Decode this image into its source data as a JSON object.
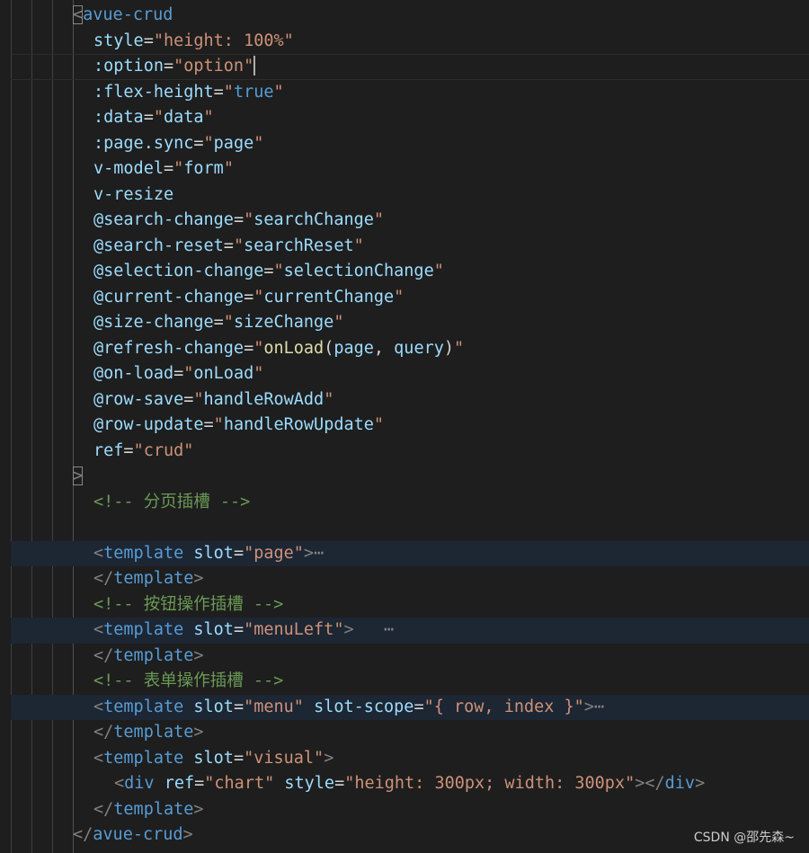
{
  "editor": {
    "lines": [
      {
        "indent": 1,
        "tokens": [
          {
            "t": "<",
            "c": "punct",
            "box": true
          },
          {
            "t": "avue-crud",
            "c": "tag"
          }
        ]
      },
      {
        "indent": 2,
        "tokens": [
          {
            "t": "style",
            "c": "attr"
          },
          {
            "t": "=",
            "c": "eq"
          },
          {
            "t": "\"height: 100%\"",
            "c": "str"
          }
        ]
      },
      {
        "indent": 2,
        "caret": true,
        "tokens": [
          {
            "t": ":option",
            "c": "attr"
          },
          {
            "t": "=",
            "c": "eq"
          },
          {
            "t": "\"option\"",
            "c": "str"
          }
        ]
      },
      {
        "indent": 2,
        "tokens": [
          {
            "t": ":flex-height",
            "c": "attr"
          },
          {
            "t": "=",
            "c": "eq"
          },
          {
            "t": "\"",
            "c": "str"
          },
          {
            "t": "true",
            "c": "kw"
          },
          {
            "t": "\"",
            "c": "str"
          }
        ]
      },
      {
        "indent": 2,
        "tokens": [
          {
            "t": ":data",
            "c": "attr"
          },
          {
            "t": "=",
            "c": "eq"
          },
          {
            "t": "\"",
            "c": "str"
          },
          {
            "t": "data",
            "c": "var"
          },
          {
            "t": "\"",
            "c": "str"
          }
        ]
      },
      {
        "indent": 2,
        "tokens": [
          {
            "t": ":page.sync",
            "c": "attr"
          },
          {
            "t": "=",
            "c": "eq"
          },
          {
            "t": "\"",
            "c": "str"
          },
          {
            "t": "page",
            "c": "var"
          },
          {
            "t": "\"",
            "c": "str"
          }
        ]
      },
      {
        "indent": 2,
        "tokens": [
          {
            "t": "v-model",
            "c": "attr"
          },
          {
            "t": "=",
            "c": "eq"
          },
          {
            "t": "\"",
            "c": "str"
          },
          {
            "t": "form",
            "c": "var"
          },
          {
            "t": "\"",
            "c": "str"
          }
        ]
      },
      {
        "indent": 2,
        "tokens": [
          {
            "t": "v-resize",
            "c": "attr"
          }
        ]
      },
      {
        "indent": 2,
        "tokens": [
          {
            "t": "@search-change",
            "c": "attr"
          },
          {
            "t": "=",
            "c": "eq"
          },
          {
            "t": "\"",
            "c": "str"
          },
          {
            "t": "searchChange",
            "c": "var"
          },
          {
            "t": "\"",
            "c": "str"
          }
        ]
      },
      {
        "indent": 2,
        "tokens": [
          {
            "t": "@search-reset",
            "c": "attr"
          },
          {
            "t": "=",
            "c": "eq"
          },
          {
            "t": "\"",
            "c": "str"
          },
          {
            "t": "searchReset",
            "c": "var"
          },
          {
            "t": "\"",
            "c": "str"
          }
        ]
      },
      {
        "indent": 2,
        "tokens": [
          {
            "t": "@selection-change",
            "c": "attr"
          },
          {
            "t": "=",
            "c": "eq"
          },
          {
            "t": "\"",
            "c": "str"
          },
          {
            "t": "selectionChange",
            "c": "var"
          },
          {
            "t": "\"",
            "c": "str"
          }
        ]
      },
      {
        "indent": 2,
        "tokens": [
          {
            "t": "@current-change",
            "c": "attr"
          },
          {
            "t": "=",
            "c": "eq"
          },
          {
            "t": "\"",
            "c": "str"
          },
          {
            "t": "currentChange",
            "c": "var"
          },
          {
            "t": "\"",
            "c": "str"
          }
        ]
      },
      {
        "indent": 2,
        "tokens": [
          {
            "t": "@size-change",
            "c": "attr"
          },
          {
            "t": "=",
            "c": "eq"
          },
          {
            "t": "\"",
            "c": "str"
          },
          {
            "t": "sizeChange",
            "c": "var"
          },
          {
            "t": "\"",
            "c": "str"
          }
        ]
      },
      {
        "indent": 2,
        "tokens": [
          {
            "t": "@refresh-change",
            "c": "attr"
          },
          {
            "t": "=",
            "c": "eq"
          },
          {
            "t": "\"",
            "c": "str"
          },
          {
            "t": "onLoad",
            "c": "fn"
          },
          {
            "t": "(",
            "c": "plain"
          },
          {
            "t": "page",
            "c": "var"
          },
          {
            "t": ", ",
            "c": "plain"
          },
          {
            "t": "query",
            "c": "var"
          },
          {
            "t": ")",
            "c": "plain"
          },
          {
            "t": "\"",
            "c": "str"
          }
        ]
      },
      {
        "indent": 2,
        "tokens": [
          {
            "t": "@on-load",
            "c": "attr"
          },
          {
            "t": "=",
            "c": "eq"
          },
          {
            "t": "\"",
            "c": "str"
          },
          {
            "t": "onLoad",
            "c": "var"
          },
          {
            "t": "\"",
            "c": "str"
          }
        ]
      },
      {
        "indent": 2,
        "tokens": [
          {
            "t": "@row-save",
            "c": "attr"
          },
          {
            "t": "=",
            "c": "eq"
          },
          {
            "t": "\"",
            "c": "str"
          },
          {
            "t": "handleRowAdd",
            "c": "var"
          },
          {
            "t": "\"",
            "c": "str"
          }
        ]
      },
      {
        "indent": 2,
        "tokens": [
          {
            "t": "@row-update",
            "c": "attr"
          },
          {
            "t": "=",
            "c": "eq"
          },
          {
            "t": "\"",
            "c": "str"
          },
          {
            "t": "handleRowUpdate",
            "c": "var"
          },
          {
            "t": "\"",
            "c": "str"
          }
        ]
      },
      {
        "indent": 2,
        "tokens": [
          {
            "t": "ref",
            "c": "attr"
          },
          {
            "t": "=",
            "c": "eq"
          },
          {
            "t": "\"crud\"",
            "c": "str"
          }
        ]
      },
      {
        "indent": 1,
        "tokens": [
          {
            "t": ">",
            "c": "punct",
            "box": true
          }
        ]
      },
      {
        "indent": 2,
        "tokens": [
          {
            "t": "<!-- 分页插槽 -->",
            "c": "comment"
          }
        ]
      },
      {
        "indent": 2,
        "tokens": []
      },
      {
        "indent": 2,
        "hl": true,
        "tokens": [
          {
            "t": "<",
            "c": "punct"
          },
          {
            "t": "template",
            "c": "tag"
          },
          {
            "t": " ",
            "c": "plain"
          },
          {
            "t": "slot",
            "c": "attr"
          },
          {
            "t": "=",
            "c": "eq"
          },
          {
            "t": "\"page\"",
            "c": "str"
          },
          {
            "t": ">",
            "c": "punct"
          },
          {
            "t": "⋯",
            "c": "fold"
          }
        ]
      },
      {
        "indent": 2,
        "tokens": [
          {
            "t": "</",
            "c": "punct"
          },
          {
            "t": "template",
            "c": "tag"
          },
          {
            "t": ">",
            "c": "punct"
          }
        ]
      },
      {
        "indent": 2,
        "tokens": [
          {
            "t": "<!-- 按钮操作插槽 -->",
            "c": "comment"
          }
        ]
      },
      {
        "indent": 2,
        "hl": true,
        "tokens": [
          {
            "t": "<",
            "c": "punct"
          },
          {
            "t": "template",
            "c": "tag"
          },
          {
            "t": " ",
            "c": "plain"
          },
          {
            "t": "slot",
            "c": "attr"
          },
          {
            "t": "=",
            "c": "eq"
          },
          {
            "t": "\"menuLeft\"",
            "c": "str"
          },
          {
            "t": ">",
            "c": "punct"
          },
          {
            "t": "   ⋯",
            "c": "fold"
          }
        ]
      },
      {
        "indent": 2,
        "tokens": [
          {
            "t": "</",
            "c": "punct"
          },
          {
            "t": "template",
            "c": "tag"
          },
          {
            "t": ">",
            "c": "punct"
          }
        ]
      },
      {
        "indent": 2,
        "tokens": [
          {
            "t": "<!-- 表单操作插槽 -->",
            "c": "comment"
          }
        ]
      },
      {
        "indent": 2,
        "hl": true,
        "tokens": [
          {
            "t": "<",
            "c": "punct"
          },
          {
            "t": "template",
            "c": "tag"
          },
          {
            "t": " ",
            "c": "plain"
          },
          {
            "t": "slot",
            "c": "attr"
          },
          {
            "t": "=",
            "c": "eq"
          },
          {
            "t": "\"menu\"",
            "c": "str"
          },
          {
            "t": " ",
            "c": "plain"
          },
          {
            "t": "slot-scope",
            "c": "attr"
          },
          {
            "t": "=",
            "c": "eq"
          },
          {
            "t": "\"{ row, index }\"",
            "c": "str"
          },
          {
            "t": ">",
            "c": "punct"
          },
          {
            "t": "⋯",
            "c": "fold"
          }
        ]
      },
      {
        "indent": 2,
        "tokens": [
          {
            "t": "</",
            "c": "punct"
          },
          {
            "t": "template",
            "c": "tag"
          },
          {
            "t": ">",
            "c": "punct"
          }
        ]
      },
      {
        "indent": 2,
        "tokens": [
          {
            "t": "<",
            "c": "punct"
          },
          {
            "t": "template",
            "c": "tag"
          },
          {
            "t": " ",
            "c": "plain"
          },
          {
            "t": "slot",
            "c": "attr"
          },
          {
            "t": "=",
            "c": "eq"
          },
          {
            "t": "\"visual\"",
            "c": "str"
          },
          {
            "t": ">",
            "c": "punct"
          }
        ]
      },
      {
        "indent": 3,
        "tokens": [
          {
            "t": "<",
            "c": "punct"
          },
          {
            "t": "div",
            "c": "tag"
          },
          {
            "t": " ",
            "c": "plain"
          },
          {
            "t": "ref",
            "c": "attr"
          },
          {
            "t": "=",
            "c": "eq"
          },
          {
            "t": "\"chart\"",
            "c": "str"
          },
          {
            "t": " ",
            "c": "plain"
          },
          {
            "t": "style",
            "c": "attr"
          },
          {
            "t": "=",
            "c": "eq"
          },
          {
            "t": "\"height: 300px; width: 300px\"",
            "c": "str"
          },
          {
            "t": "></",
            "c": "punct"
          },
          {
            "t": "div",
            "c": "tag"
          },
          {
            "t": ">",
            "c": "punct"
          }
        ]
      },
      {
        "indent": 2,
        "tokens": [
          {
            "t": "</",
            "c": "punct"
          },
          {
            "t": "template",
            "c": "tag"
          },
          {
            "t": ">",
            "c": "punct"
          }
        ]
      },
      {
        "indent": 1,
        "tokens": [
          {
            "t": "</",
            "c": "punct"
          },
          {
            "t": "avue-crud",
            "c": "tag"
          },
          {
            "t": ">",
            "c": "punct"
          }
        ]
      }
    ]
  },
  "watermark": "CSDN @邵先森~",
  "colors": {
    "background": "#1e1e1e",
    "tag": "#569cd6",
    "attribute": "#9cdcfe",
    "string": "#ce9178",
    "comment": "#6a9955",
    "function": "#dcdcaa",
    "folded_line_highlight": "#1d2633"
  }
}
